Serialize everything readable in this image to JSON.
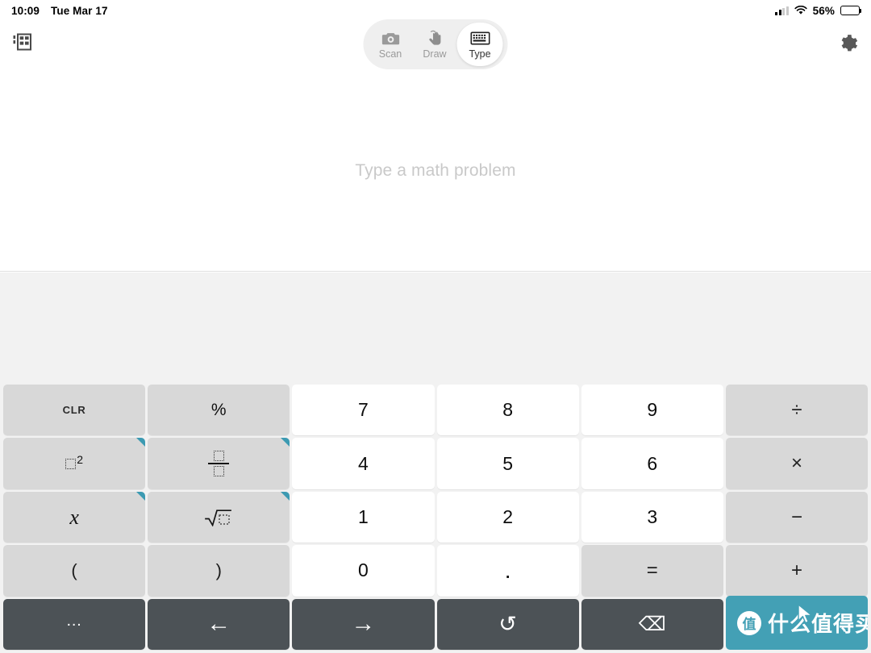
{
  "status_bar": {
    "time": "10:09",
    "date": "Tue Mar 17",
    "battery_percent": "56%",
    "cell_icon": "cellular-signal-icon",
    "wifi_icon": "wifi-icon",
    "battery_icon": "battery-icon"
  },
  "top_bar": {
    "history_icon": "history-list-icon",
    "settings_icon": "gear-icon",
    "modes": [
      {
        "label": "Scan",
        "icon": "camera-icon",
        "active": false
      },
      {
        "label": "Draw",
        "icon": "hand-draw-icon",
        "active": false
      },
      {
        "label": "Type",
        "icon": "keyboard-icon",
        "active": true
      }
    ]
  },
  "input_area": {
    "placeholder": "Type a math problem",
    "value": ""
  },
  "keypad": {
    "rows": [
      [
        {
          "name": "clear",
          "label": "CLR",
          "style": "fn clr"
        },
        {
          "name": "percent",
          "label": "%",
          "style": "fn"
        },
        {
          "name": "seven",
          "label": "7",
          "style": "num"
        },
        {
          "name": "eight",
          "label": "8",
          "style": "num"
        },
        {
          "name": "nine",
          "label": "9",
          "style": "num"
        },
        {
          "name": "divide",
          "label": "÷",
          "style": "fn op"
        }
      ],
      [
        {
          "name": "power-squared",
          "label": "□²",
          "style": "fn",
          "expandable": true
        },
        {
          "name": "fraction",
          "label": "□/□",
          "style": "fn",
          "expandable": true
        },
        {
          "name": "four",
          "label": "4",
          "style": "num"
        },
        {
          "name": "five",
          "label": "5",
          "style": "num"
        },
        {
          "name": "six",
          "label": "6",
          "style": "num"
        },
        {
          "name": "multiply",
          "label": "×",
          "style": "fn op"
        }
      ],
      [
        {
          "name": "variable-x",
          "label": "x",
          "style": "fn xvar",
          "expandable": true
        },
        {
          "name": "square-root",
          "label": "√□",
          "style": "fn",
          "expandable": true
        },
        {
          "name": "one",
          "label": "1",
          "style": "num"
        },
        {
          "name": "two",
          "label": "2",
          "style": "num"
        },
        {
          "name": "three",
          "label": "3",
          "style": "num"
        },
        {
          "name": "minus",
          "label": "−",
          "style": "fn op"
        }
      ],
      [
        {
          "name": "open-paren",
          "label": "(",
          "style": "fn paren"
        },
        {
          "name": "close-paren",
          "label": ")",
          "style": "fn paren"
        },
        {
          "name": "zero",
          "label": "0",
          "style": "num"
        },
        {
          "name": "decimal-point",
          "label": ".",
          "style": "num"
        },
        {
          "name": "equals",
          "label": "=",
          "style": "fn op"
        },
        {
          "name": "plus",
          "label": "+",
          "style": "fn op"
        }
      ],
      [
        {
          "name": "more-options",
          "label": "…",
          "style": "dark"
        },
        {
          "name": "cursor-left",
          "label": "←",
          "style": "dark"
        },
        {
          "name": "cursor-right",
          "label": "→",
          "style": "dark"
        },
        {
          "name": "undo",
          "label": "↺",
          "style": "dark"
        },
        {
          "name": "backspace",
          "label": "⌫",
          "style": "dark"
        },
        {
          "name": "watermark",
          "label": "",
          "style": "watermark"
        }
      ]
    ],
    "expand_marker_color": "#3c9ab2"
  },
  "watermark": {
    "logo_char": "值",
    "text": "什么值得买",
    "color": "#43a0b5"
  },
  "colors": {
    "key_function": "#d8d8d8",
    "key_number": "#ffffff",
    "key_dark": "#4c5256",
    "keypad_background": "#f2f2f2",
    "accent_teal": "#3c9ab2",
    "placeholder_gray": "#c9c9c9"
  }
}
